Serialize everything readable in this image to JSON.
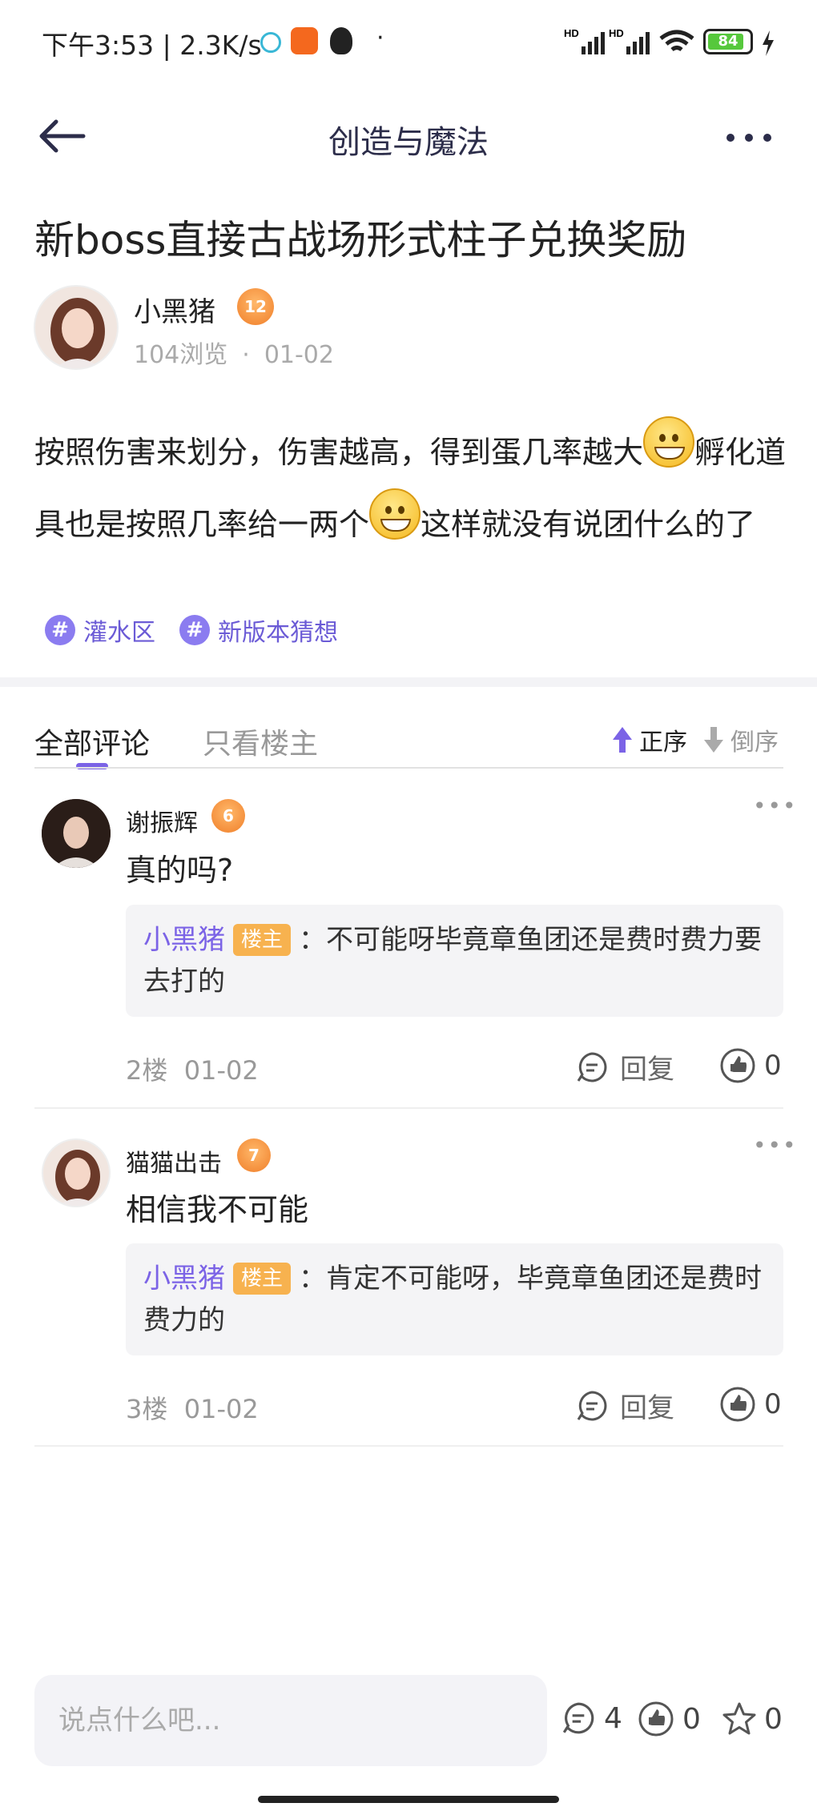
{
  "status_bar": {
    "time": "下午3:53 | 2.3K/s",
    "dot": "·",
    "battery": "84",
    "hd1": "HD",
    "hd2": "HD"
  },
  "header": {
    "title": "创造与魔法"
  },
  "post": {
    "title": "新boss直接古战场形式柱子兑换奖励",
    "author": "小黑猪",
    "author_level": "12",
    "views": "104浏览",
    "separator": "·",
    "date": "01-02",
    "body_part1": "按照伤害来划分，伤害越高，得到蛋几率越大",
    "body_part2": "孵化道具也是按照几率给一两个",
    "body_part3": "这样就没有说团什么的了",
    "tags": [
      "灌水区",
      "新版本猜想"
    ]
  },
  "tabs": {
    "all_comments": "全部评论",
    "only_op": "只看楼主",
    "sort_asc": "正序",
    "sort_desc": "倒序"
  },
  "comments": [
    {
      "name": "谢振辉",
      "level": "6",
      "text": "真的吗?",
      "reply_name": "小黑猪",
      "reply_badge": "楼主",
      "reply_sep": "：",
      "reply_text": "不可能呀毕竟章鱼团还是费时费力要去打的",
      "floor": "2楼",
      "date": "01-02",
      "reply_label": "回复",
      "likes": "0"
    },
    {
      "name": "猫猫出击",
      "level": "7",
      "text": "相信我不可能",
      "reply_name": "小黑猪",
      "reply_badge": "楼主",
      "reply_sep": "：",
      "reply_text": "肯定不可能呀，毕竟章鱼团还是费时费力的",
      "floor": "3楼",
      "date": "01-02",
      "reply_label": "回复",
      "likes": "0"
    }
  ],
  "bottom_bar": {
    "input_placeholder": "说点什么吧...",
    "comment_count": "4",
    "like_count": "0",
    "fav_count": "0"
  },
  "colors": {
    "accent": "#7b63e6",
    "badge": "#f7b24f",
    "level": "#f07f2a"
  }
}
